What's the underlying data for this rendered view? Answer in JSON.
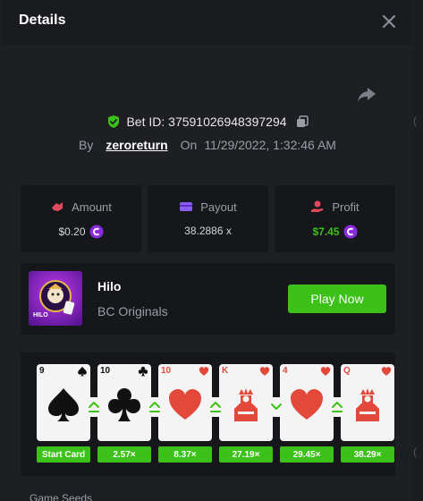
{
  "modal": {
    "title": "Details"
  },
  "bet": {
    "id_label": "Bet ID: 37591026948397294",
    "by_label": "By",
    "username": "zeroreturn",
    "on_label": "On",
    "timestamp": "11/29/2022, 1:32:46 AM"
  },
  "stats": {
    "amount": {
      "label": "Amount",
      "value": "$0.20"
    },
    "payout": {
      "label": "Payout",
      "value": "38.2886 x"
    },
    "profit": {
      "label": "Profit",
      "value": "$7.45"
    }
  },
  "game": {
    "name": "Hilo",
    "provider": "BC Originals",
    "thumb_label": "HILO",
    "play_label": "Play Now"
  },
  "cards": [
    {
      "rank": "9",
      "suit": "spade",
      "color": "#111111",
      "multiplier": "Start Card"
    },
    {
      "rank": "10",
      "suit": "club",
      "color": "#111111",
      "multiplier": "2.57×"
    },
    {
      "rank": "10",
      "suit": "heart",
      "color": "#e2493b",
      "multiplier": "8.37×"
    },
    {
      "rank": "K",
      "suit": "heart",
      "color": "#e2493b",
      "multiplier": "27.19×"
    },
    {
      "rank": "4",
      "suit": "heart",
      "color": "#e2493b",
      "multiplier": "29.45×"
    },
    {
      "rank": "Q",
      "suit": "heart",
      "color": "#e2493b",
      "multiplier": "38.29×"
    }
  ],
  "guesses": [
    "higher",
    "higher",
    "higher",
    "lower",
    "higher"
  ],
  "colors": {
    "accent_green": "#3bc117",
    "profit_green": "#3bc117",
    "heart_red": "#e2493b",
    "coin_purple": "#8a2be2"
  }
}
